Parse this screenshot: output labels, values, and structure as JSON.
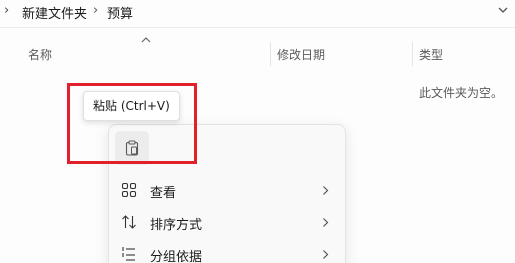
{
  "address_bar": {
    "crumbs": [
      "新建文件夹",
      "预算"
    ],
    "separator": "›"
  },
  "columns": {
    "name": "名称",
    "date_modified": "修改日期",
    "type": "类型"
  },
  "empty_message": "此文件夹为空。",
  "tooltip": "粘贴 (Ctrl+V)",
  "context_menu": {
    "paste_icon": "clipboard-icon",
    "items": [
      {
        "label": "查看",
        "icon": "grid-icon",
        "has_submenu": true
      },
      {
        "label": "排序方式",
        "icon": "sort-arrows-icon",
        "has_submenu": true
      },
      {
        "label": "分组依据",
        "icon": "group-list-icon",
        "has_submenu": true
      }
    ]
  },
  "colors": {
    "highlight": "#e0202a",
    "menu_bg": "#f9f9f9"
  }
}
